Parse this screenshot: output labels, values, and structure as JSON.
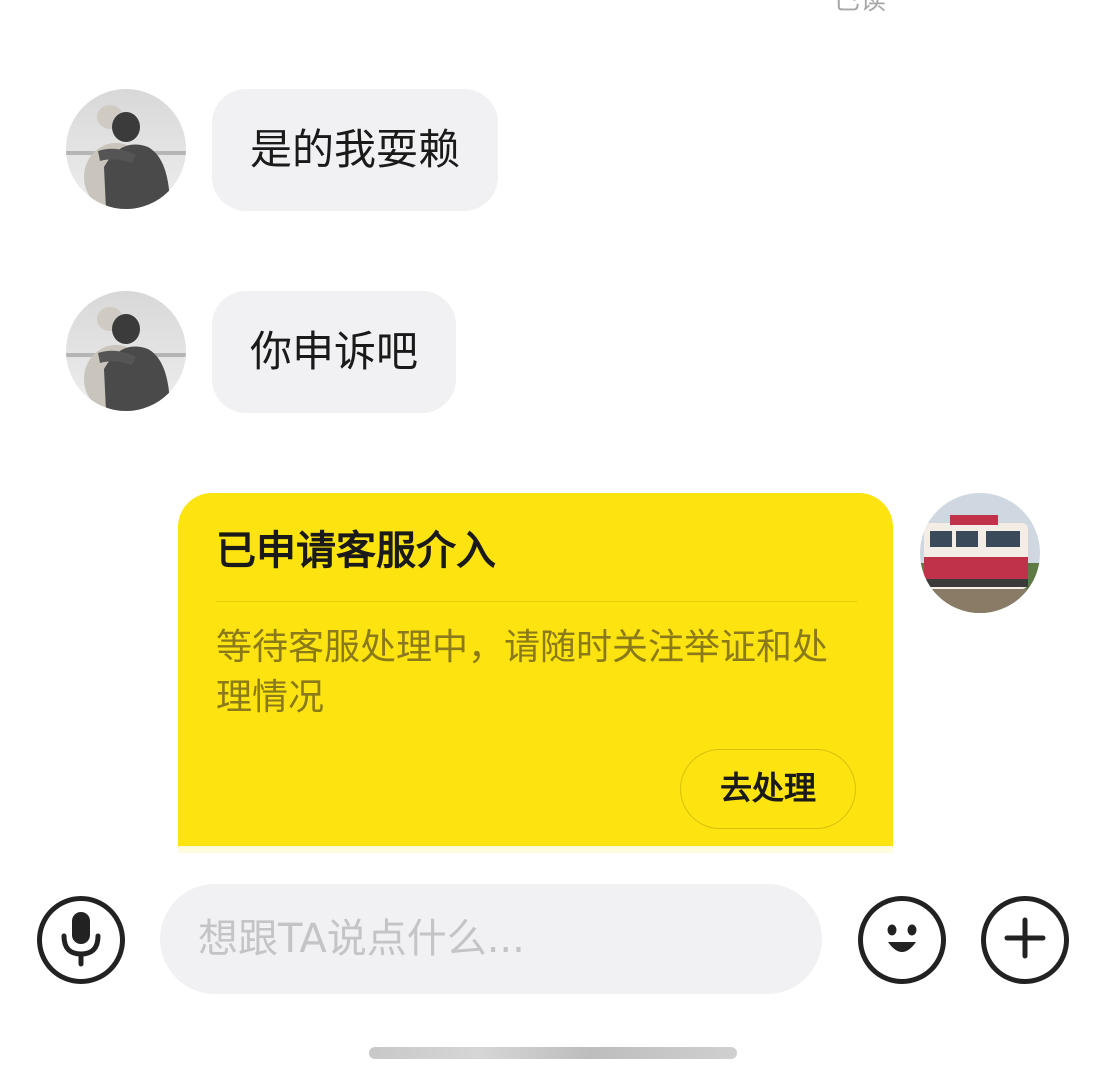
{
  "read_receipt": "已读",
  "messages": [
    {
      "side": "left",
      "avatar": "person-hugging-dog-avatar",
      "text": "是的我耍赖"
    },
    {
      "side": "left",
      "avatar": "person-hugging-dog-avatar",
      "text": "你申诉吧"
    }
  ],
  "service_card": {
    "side": "right",
    "avatar": "red-train-avatar",
    "title": "已申请客服介入",
    "body": "等待客服处理中，请随时关注举证和处理情况",
    "button_label": "去处理",
    "background_color": "#fde30f"
  },
  "input_bar": {
    "voice_icon": "microphone-icon",
    "placeholder": "想跟TA说点什么...",
    "emoji_icon": "smiley-icon",
    "more_icon": "plus-icon"
  }
}
